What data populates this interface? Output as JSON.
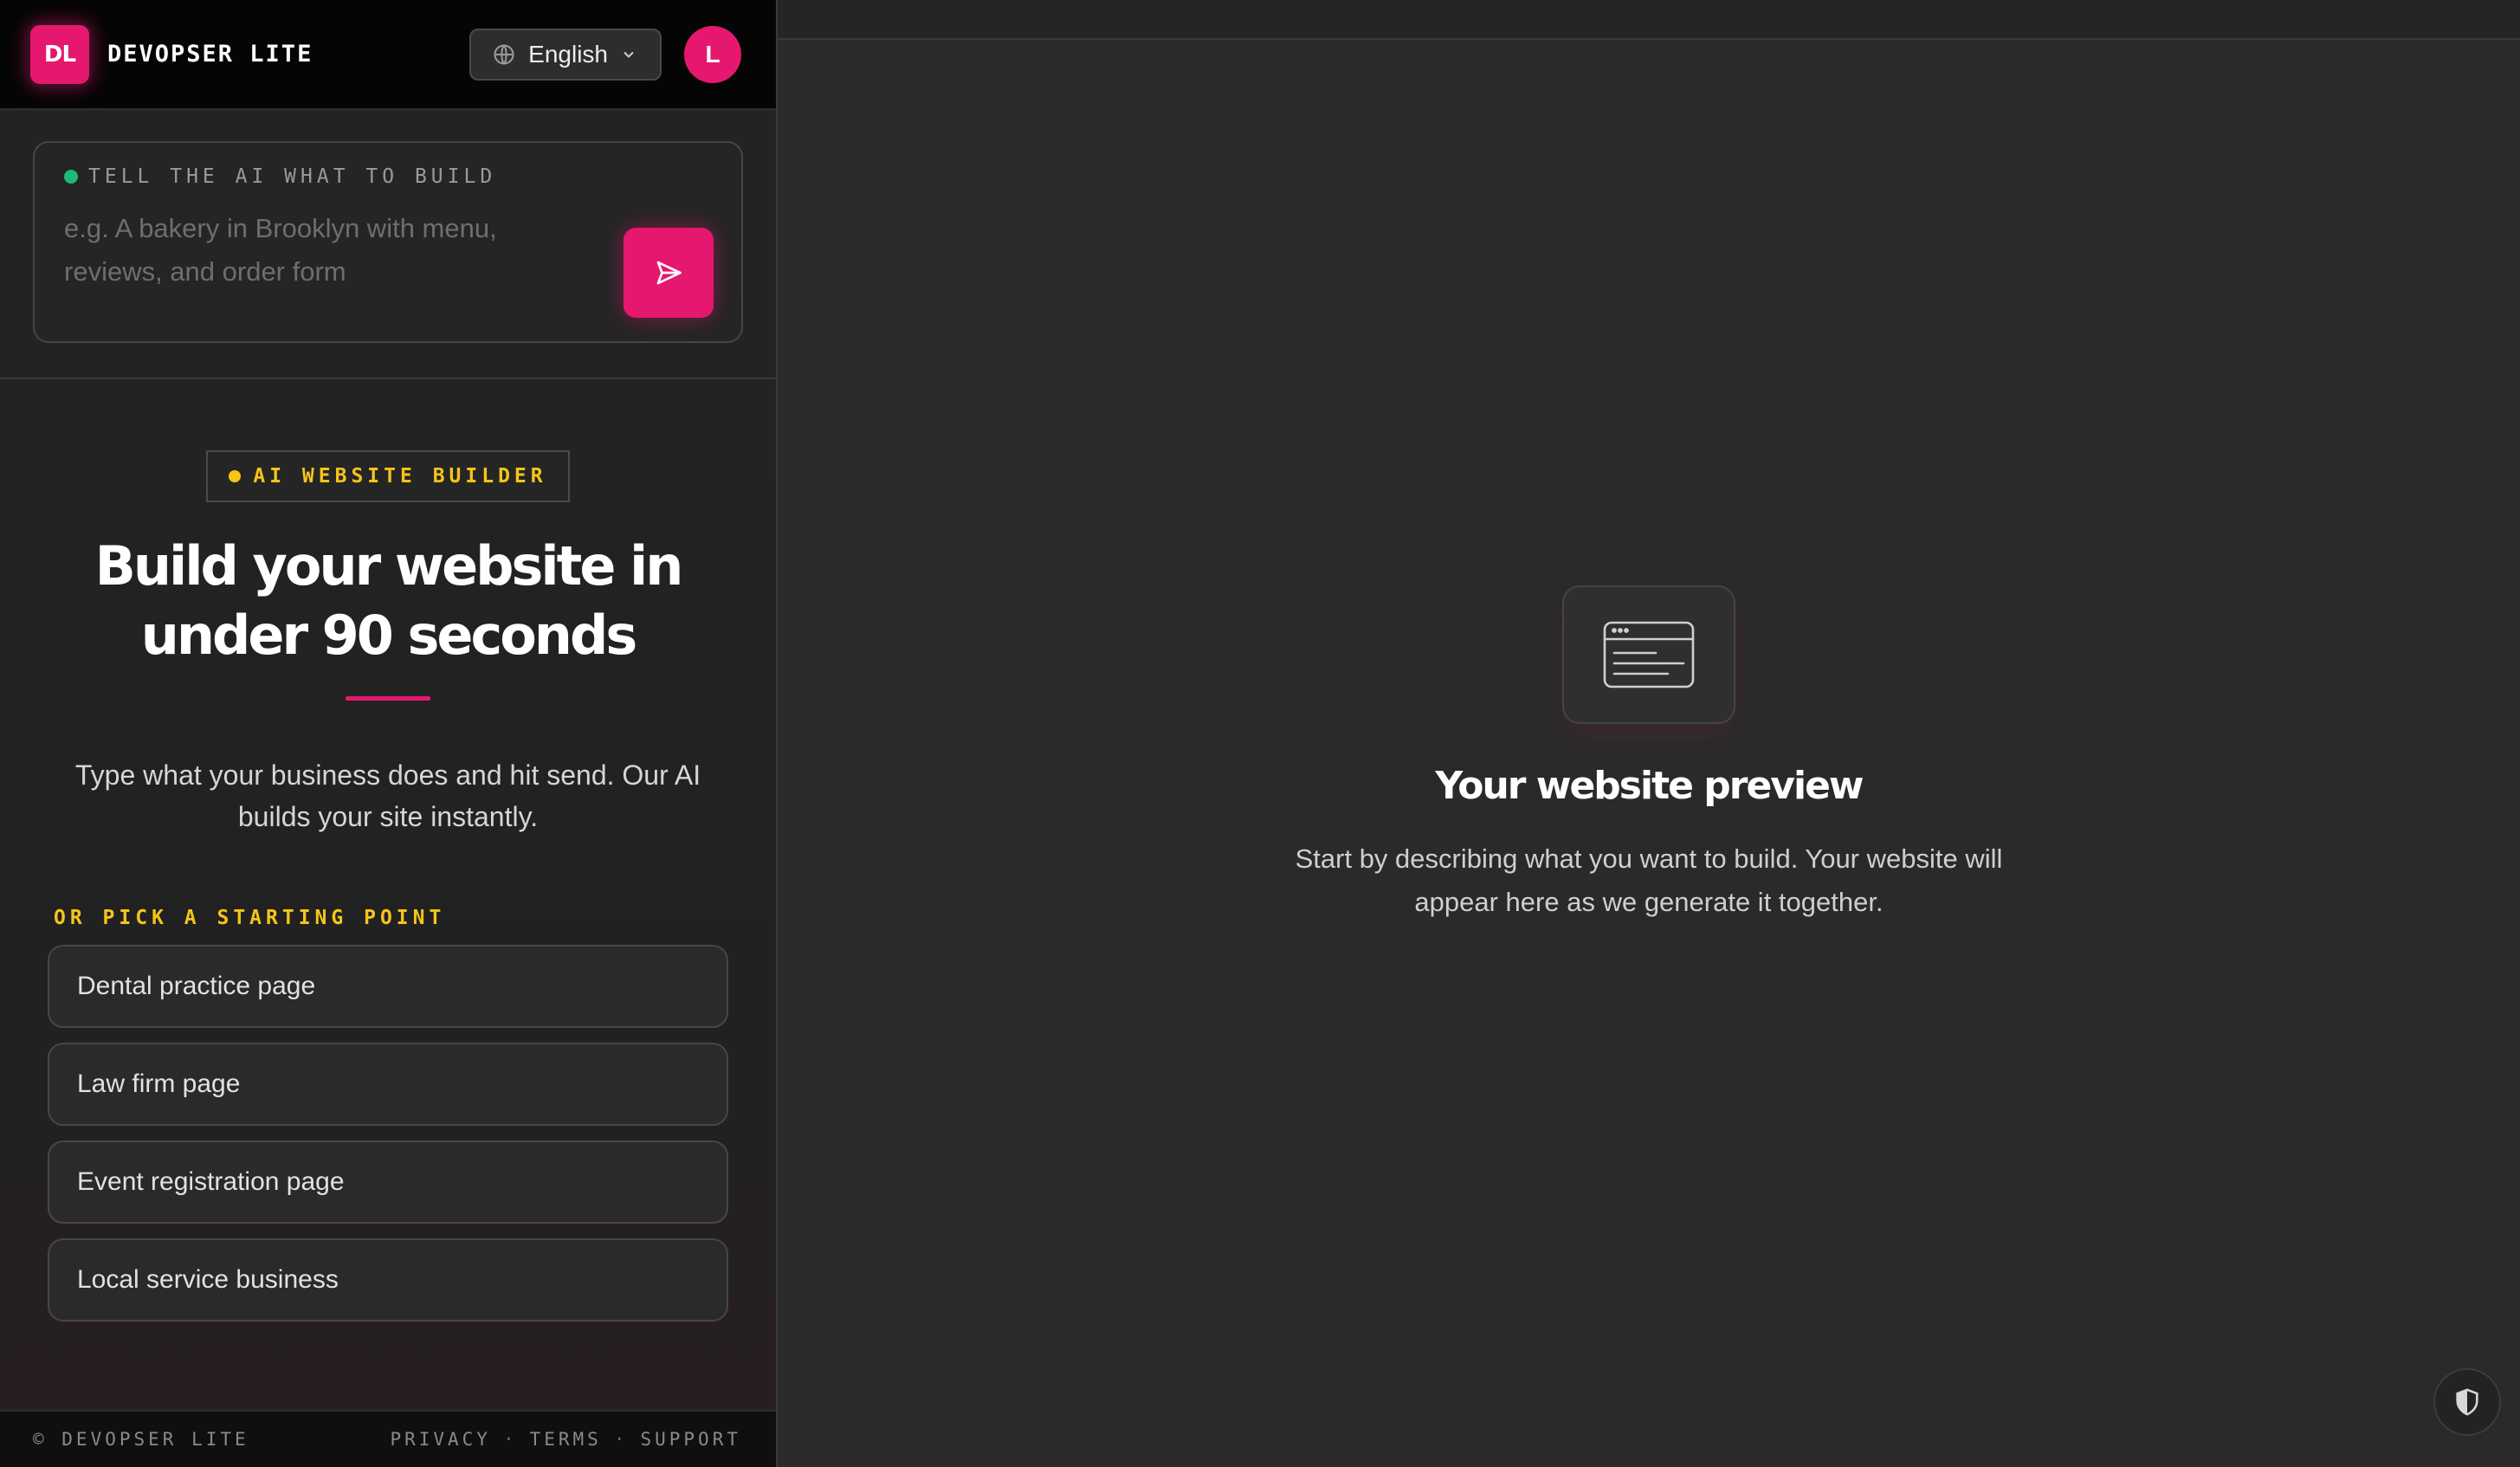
{
  "header": {
    "logo_initials": "DL",
    "brand_name": "DEVOPSER LITE",
    "language": "English",
    "avatar_initial": "L"
  },
  "prompt": {
    "label": "TELL THE AI WHAT TO BUILD",
    "placeholder": "e.g. A bakery in Brooklyn with menu, reviews, and order form",
    "value": ""
  },
  "hero": {
    "badge": "AI WEBSITE BUILDER",
    "headline": "Build your website in under 90 seconds",
    "subtext": "Type what your business does and hit send. Our AI builds your site instantly."
  },
  "starting_points": {
    "label": "OR PICK A STARTING POINT",
    "items": [
      "Dental practice page",
      "Law firm page",
      "Event registration page",
      "Local service business"
    ]
  },
  "footer": {
    "copyright": "© DEVOPSER LITE",
    "links": [
      "PRIVACY",
      "TERMS",
      "SUPPORT"
    ],
    "separator": "·"
  },
  "preview": {
    "title": "Your website preview",
    "subtitle": "Start by describing what you want to build. Your website will appear here as we generate it together."
  },
  "colors": {
    "accent": "#e6176e",
    "highlight": "#f5c518",
    "status_dot": "#1fb97a",
    "background": "#2a2a2a"
  },
  "icons": {
    "language": "globe-icon",
    "dropdown": "chevron-down-icon",
    "send": "send-icon",
    "preview": "browser-window-icon",
    "privacy": "shield-icon"
  }
}
